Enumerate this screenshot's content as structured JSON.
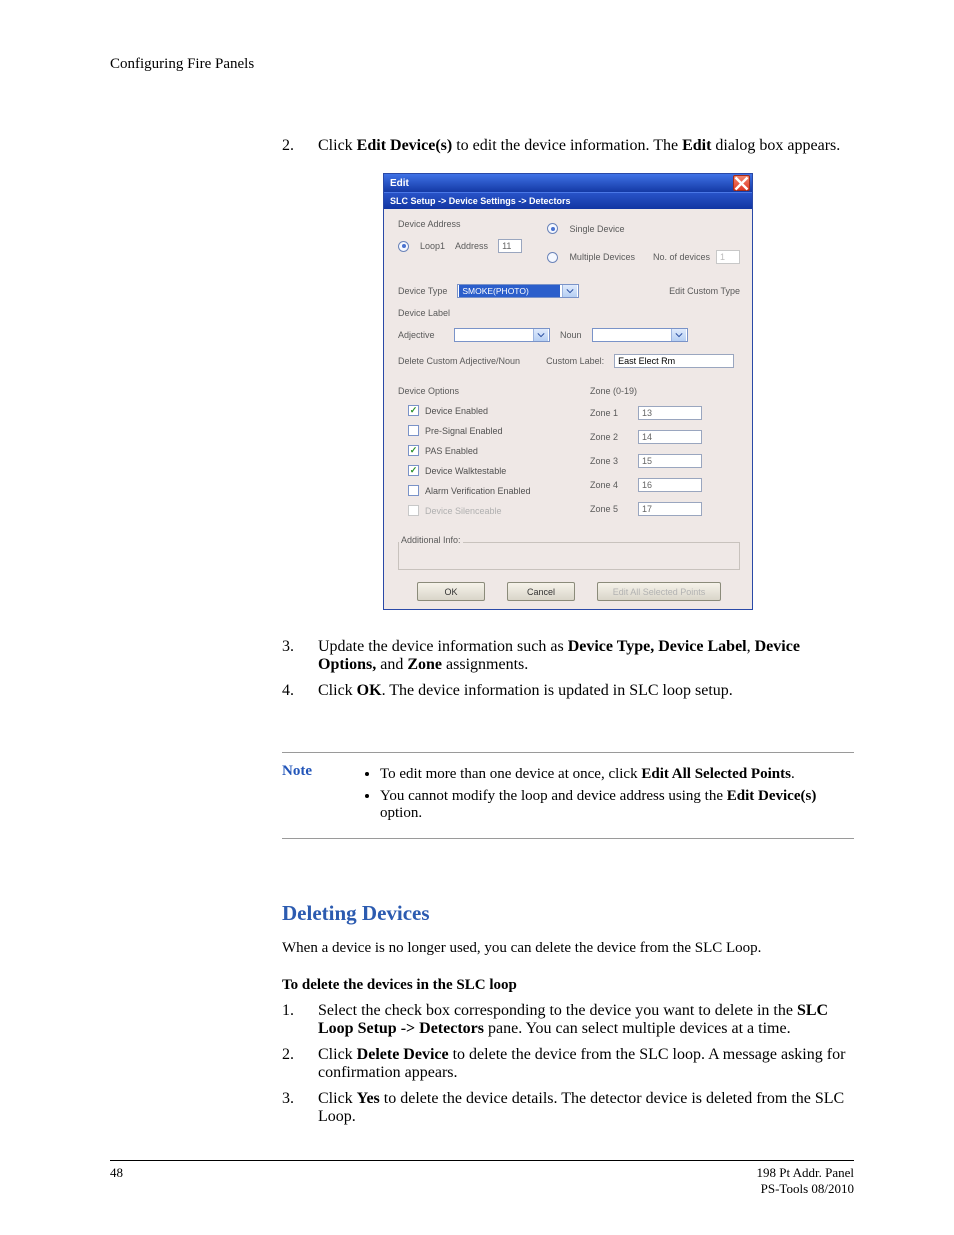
{
  "running_head": "Configuring Fire Panels",
  "step2": {
    "num": "2.",
    "pre": "Click ",
    "b1": "Edit Device(s)",
    "mid": " to edit the device information. The ",
    "b2": "Edit",
    "post": " dialog box appears."
  },
  "dlg": {
    "title": "Edit",
    "crumb": "SLC Setup -> Device Settings -> Detectors",
    "device_address": "Device Address",
    "loop1": "Loop1",
    "address_lbl": "Address",
    "address_val": "11",
    "single_device": "Single Device",
    "multiple_devices": "Multiple Devices",
    "no_of_devices": "No. of devices",
    "no_val": "1",
    "device_type_lbl": "Device Type",
    "device_type_val": "SMOKE(PHOTO)",
    "edit_custom_type": "Edit Custom Type",
    "device_label": "Device Label",
    "adjective": "Adjective",
    "noun": "Noun",
    "delete_custom": "Delete Custom Adjective/Noun",
    "custom_label": "Custom Label:",
    "custom_label_val": "East Elect Rm",
    "device_options": "Device Options",
    "opts": {
      "enabled": "Device Enabled",
      "presignal": "Pre-Signal Enabled",
      "pas": "PAS Enabled",
      "walk": "Device Walktestable",
      "alarm_verif": "Alarm Verification Enabled",
      "silenceable": "Device Silenceable"
    },
    "zone_head": "Zone (0-19)",
    "zones": [
      {
        "lbl": "Zone 1",
        "val": "13"
      },
      {
        "lbl": "Zone 2",
        "val": "14"
      },
      {
        "lbl": "Zone 3",
        "val": "15"
      },
      {
        "lbl": "Zone 4",
        "val": "16"
      },
      {
        "lbl": "Zone 5",
        "val": "17"
      }
    ],
    "additional_info": "Additional Info:",
    "ok": "OK",
    "cancel": "Cancel",
    "edit_all": "Edit All Selected Points"
  },
  "step3": {
    "num": "3.",
    "pre": "Update the device information such as ",
    "b1": "Device Type, Device Label",
    "mid1": ", ",
    "b2": "Device Options,",
    "mid2": " and ",
    "b3": "Zone",
    "post": " assignments."
  },
  "step4": {
    "num": "4.",
    "pre": "Click ",
    "b": "OK",
    "post": ". The device information is updated in SLC loop setup."
  },
  "note": {
    "label": "Note",
    "item1": {
      "pre": "To edit more than one device at once, click ",
      "b": "Edit All Selected Points",
      "post": "."
    },
    "item2": {
      "pre": "You cannot modify the loop and device address using the ",
      "b": "Edit Device(s)",
      "post": " option."
    }
  },
  "heading": "Deleting Devices",
  "intro": "When a device is no longer used, you can delete the device from the SLC Loop.",
  "subhead": "To delete the devices in the SLC loop",
  "del1": {
    "num": "1.",
    "pre": "Select the check box corresponding to the device you want to delete in the ",
    "b": "SLC Loop Setup -> Detectors",
    "post": " pane. You can select multiple devices at a time."
  },
  "del2": {
    "num": "2.",
    "pre": "Click ",
    "b": "Delete Device",
    "post": " to delete the device from the SLC loop. A message asking for confirmation appears."
  },
  "del3": {
    "num": "3.",
    "pre": "Click ",
    "b": "Yes",
    "post": " to delete the device details. The detector device is deleted from the SLC Loop."
  },
  "footer": {
    "page": "48",
    "line1": "198 Pt Addr. Panel",
    "line2": "PS-Tools   08/2010"
  }
}
